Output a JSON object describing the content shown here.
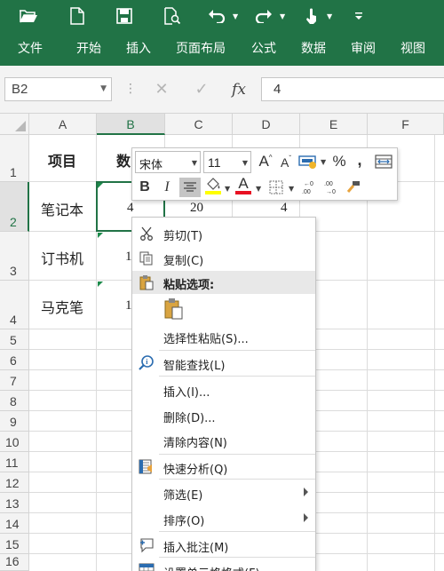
{
  "ribbon": {
    "tabs": [
      "文件",
      "开始",
      "插入",
      "页面布局",
      "公式",
      "数据",
      "审阅",
      "视图"
    ],
    "bg_color": "#217346"
  },
  "quick_access": [
    "open-folder-icon",
    "new-file-icon",
    "save-icon",
    "print-preview-icon",
    "undo-icon",
    "redo-icon",
    "touch-mode-icon",
    "customize-icon"
  ],
  "formula_bar": {
    "name_box": "B2",
    "cancel_icon": "✕",
    "enter_icon": "✓",
    "fx_icon": "fx",
    "content": "4"
  },
  "sheet": {
    "columns": [
      "A",
      "B",
      "C",
      "D",
      "E",
      "F"
    ],
    "rows": [
      "1",
      "2",
      "3",
      "4",
      "5",
      "6",
      "7",
      "8",
      "9",
      "10",
      "11",
      "12",
      "13",
      "14",
      "15",
      "16"
    ],
    "cells": {
      "A1": "项目",
      "B1": "数",
      "A2": "笔记本",
      "B2": "4",
      "C2": "20",
      "D2": "4",
      "A3": "订书机",
      "B3": "1",
      "A4": "马克笔",
      "B4": "1"
    },
    "selected_cell": "B2"
  },
  "mini_toolbar": {
    "font_name": "宋体",
    "font_size": "11",
    "increase_font": "A",
    "decrease_font": "A",
    "percent": "%",
    "comma": ",",
    "bold": "B",
    "italic": "I",
    "font_color_letter": "A",
    "fill_color": "#ffff00",
    "font_color": "#e81123"
  },
  "context_menu": {
    "cut": "剪切(T)",
    "copy": "复制(C)",
    "paste_options": "粘贴选项:",
    "paste_special": "选择性粘贴(S)...",
    "smart_lookup": "智能查找(L)",
    "insert": "插入(I)...",
    "delete": "删除(D)...",
    "clear_contents": "清除内容(N)",
    "quick_analysis": "快速分析(Q)",
    "filter": "筛选(E)",
    "sort": "排序(O)",
    "insert_comment": "插入批注(M)",
    "format_cells": "设置单元格格式(F)..."
  }
}
